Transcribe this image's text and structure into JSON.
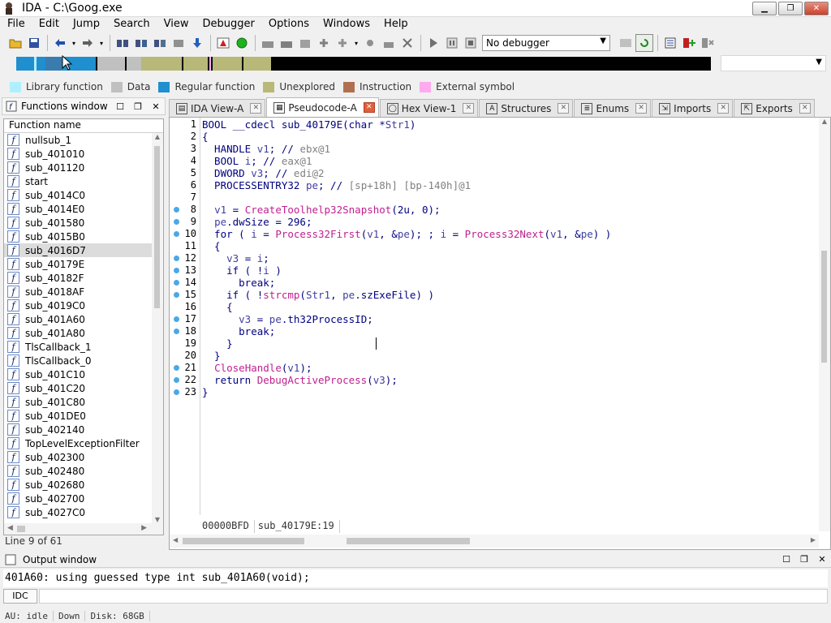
{
  "window": {
    "title": "IDA - C:\\Goog.exe",
    "minimize": "▁",
    "restore": "❐",
    "close": "✕"
  },
  "menu": [
    "File",
    "Edit",
    "Jump",
    "Search",
    "View",
    "Debugger",
    "Options",
    "Windows",
    "Help"
  ],
  "toolbar": {
    "debugger_select": "No debugger"
  },
  "legend": [
    {
      "label": "Library function",
      "color": "#aef0ff"
    },
    {
      "label": "Data",
      "color": "#c0c0c0"
    },
    {
      "label": "Regular function",
      "color": "#1f8fcf"
    },
    {
      "label": "Unexplored",
      "color": "#b8b878"
    },
    {
      "label": "Instruction",
      "color": "#b07050"
    },
    {
      "label": "External symbol",
      "color": "#ffaaee"
    }
  ],
  "functions_window": {
    "title": "Functions window",
    "column_header": "Function name",
    "items": [
      "nullsub_1",
      "sub_401010",
      "sub_401120",
      "start",
      "sub_4014C0",
      "sub_4014E0",
      "sub_401580",
      "sub_4015B0",
      "sub_4016D7",
      "sub_40179E",
      "sub_40182F",
      "sub_4018AF",
      "sub_4019C0",
      "sub_401A60",
      "sub_401A80",
      "TlsCallback_1",
      "TlsCallback_0",
      "sub_401C10",
      "sub_401C20",
      "sub_401C80",
      "sub_401DE0",
      "sub_402140",
      "TopLevelExceptionFilter",
      "sub_402300",
      "sub_402480",
      "sub_402680",
      "sub_402700",
      "sub_4027C0"
    ],
    "selected": "sub_4016D7",
    "status": "Line 9 of 61"
  },
  "tabs": [
    {
      "label": "IDA View-A",
      "icon": "ida-view-icon",
      "active": false
    },
    {
      "label": "Pseudocode-A",
      "icon": "pseudocode-icon",
      "active": true
    },
    {
      "label": "Hex View-1",
      "icon": "hex-view-icon",
      "active": false
    },
    {
      "label": "Structures",
      "icon": "structures-icon",
      "active": false
    },
    {
      "label": "Enums",
      "icon": "enums-icon",
      "active": false
    },
    {
      "label": "Imports",
      "icon": "imports-icon",
      "active": false
    },
    {
      "label": "Exports",
      "icon": "exports-icon",
      "active": false
    }
  ],
  "pseudocode": {
    "lines": [
      {
        "n": "1",
        "dot": false,
        "text": "BOOL __cdecl sub_40179E(char *Str1)"
      },
      {
        "n": "2",
        "dot": false,
        "text": "{"
      },
      {
        "n": "3",
        "dot": false,
        "text": "  HANDLE v1; // ebx@1"
      },
      {
        "n": "4",
        "dot": false,
        "text": "  BOOL i; // eax@1"
      },
      {
        "n": "5",
        "dot": false,
        "text": "  DWORD v3; // edi@2"
      },
      {
        "n": "6",
        "dot": false,
        "text": "  PROCESSENTRY32 pe; // [sp+18h] [bp-140h]@1"
      },
      {
        "n": "7",
        "dot": false,
        "text": ""
      },
      {
        "n": "8",
        "dot": true,
        "text": "  v1 = CreateToolhelp32Snapshot(2u, 0);"
      },
      {
        "n": "9",
        "dot": true,
        "text": "  pe.dwSize = 296;"
      },
      {
        "n": "10",
        "dot": true,
        "text": "  for ( i = Process32First(v1, &pe); ; i = Process32Next(v1, &pe) )"
      },
      {
        "n": "11",
        "dot": false,
        "text": "  {"
      },
      {
        "n": "12",
        "dot": true,
        "text": "    v3 = i;"
      },
      {
        "n": "13",
        "dot": true,
        "text": "    if ( !i )"
      },
      {
        "n": "14",
        "dot": true,
        "text": "      break;"
      },
      {
        "n": "15",
        "dot": true,
        "text": "    if ( !strcmp(Str1, pe.szExeFile) )"
      },
      {
        "n": "16",
        "dot": false,
        "text": "    {"
      },
      {
        "n": "17",
        "dot": true,
        "text": "      v3 = pe.th32ProcessID;"
      },
      {
        "n": "18",
        "dot": true,
        "text": "      break;"
      },
      {
        "n": "19",
        "dot": false,
        "text": "    }"
      },
      {
        "n": "20",
        "dot": false,
        "text": "  }"
      },
      {
        "n": "21",
        "dot": true,
        "text": "  CloseHandle(v1);"
      },
      {
        "n": "22",
        "dot": true,
        "text": "  return DebugActiveProcess(v3);"
      },
      {
        "n": "23",
        "dot": true,
        "text": "}"
      }
    ],
    "address": "00000BFD",
    "location": "sub_40179E:19"
  },
  "output_window": {
    "title": "Output window",
    "text": "401A60: using guessed type int sub_401A60(void);"
  },
  "idc_button": "IDC",
  "status": {
    "au": "AU:  idle",
    "dir": "Down",
    "disk": "Disk: 68GB"
  }
}
